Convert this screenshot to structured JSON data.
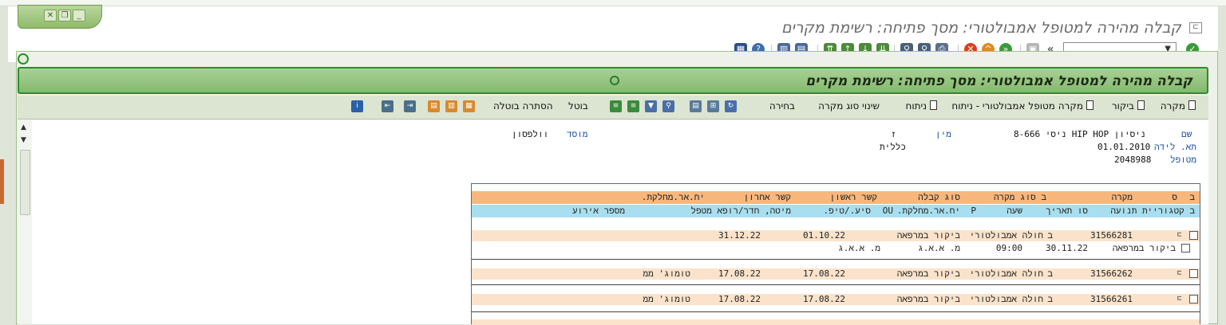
{
  "window": {
    "title": "קבלה מהירה למטופל אמבולטורי: מסך פתיחה: רשימת מקרים",
    "command_field_value": ""
  },
  "screen": {
    "header_title": "קבלה מהירה למטופל אמבולטורי: מסך פתיחה: רשימת מקרים"
  },
  "app_toolbar": {
    "buttons": [
      {
        "label": "מקרה"
      },
      {
        "label": "ביקור"
      },
      {
        "label": "מקרה מטופל אמבולטורי - ניתוח"
      },
      {
        "label": "ניתוח"
      },
      {
        "label": "שינוי סוג מקרה"
      },
      {
        "label": "בחירה"
      },
      {
        "label": "בוטל"
      },
      {
        "label": "הסתרה בוטלה"
      }
    ]
  },
  "patient": {
    "name_label": "שם",
    "name_value": "ניסיון HIP HOP ניסי 8-666",
    "gender_label": "מין",
    "gender_value": "ז",
    "dob_label": "תא. לידה",
    "dob_value": "01.01.2010",
    "insurance_value": "כללית",
    "patient_label": "מטופל",
    "patient_value": "2048988",
    "institution_label": "מוסד",
    "institution_value": "וולפסון"
  },
  "table": {
    "header1": [
      "ב",
      "ס",
      "מקרה",
      "ב סוג מקרה",
      "סוג קבלה",
      "קשר ראשון",
      "קשר אחרון",
      "יח.אר.מחלקת."
    ],
    "header2": [
      "ב קטגוריית תנועה",
      "סו תאריך",
      "שעה",
      "P",
      "יח.אר.מחלקת.",
      "OU",
      "סיע./טיפ.",
      "מיטה, חדר/רופא מטפל",
      "מספר אירוע"
    ],
    "rows": [
      {
        "case": "31566281",
        "type_code": "ב",
        "case_type": "חולה אמבולטורי",
        "admission_type": "ביקור במרפאה",
        "first_contact": "01.10.22",
        "last_contact": "31.12.22",
        "dept": ""
      },
      {
        "case": "31566262",
        "type_code": "ב",
        "case_type": "חולה אמבולטורי",
        "admission_type": "ביקור במרפאה",
        "first_contact": "17.08.22",
        "last_contact": "17.08.22",
        "dept": "טומוג' ממ"
      },
      {
        "case": "31566261",
        "type_code": "ב",
        "case_type": "חולה אמבולטורי",
        "admission_type": "ביקור במרפאה",
        "first_contact": "17.08.22",
        "last_contact": "17.08.22",
        "dept": "טומוג' ממ"
      }
    ],
    "sub_row": {
      "movement": "ביקור במרפאה",
      "date": "30.11.22",
      "time": "09:00",
      "unit": "מ. א.א.ג",
      "ou": "מ. א.א.ג"
    }
  },
  "colors": {
    "header_band": "#84b96e",
    "table_header1": "#f7b77d",
    "table_header2": "#a8dff0",
    "row_band": "#fbe3cb"
  }
}
